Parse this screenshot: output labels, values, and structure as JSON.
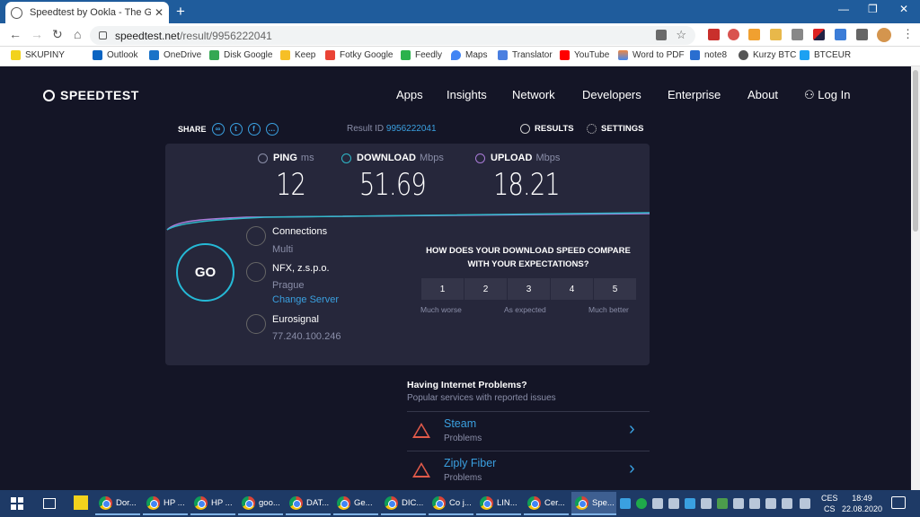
{
  "browser": {
    "tab_title": "Speedtest by Ookla - The Global",
    "tab_close": "✕",
    "new_tab": "+",
    "url_host": "speedtest.net",
    "url_path": "/result/9956222041",
    "bookmarks": [
      "SKUPINY",
      "Outlook",
      "OneDrive",
      "Disk Google",
      "Keep",
      "Fotky Google",
      "Feedly",
      "Maps",
      "Translator",
      "YouTube",
      "Word to PDF",
      "note8",
      "Kurzy BTC",
      "BTCEUR"
    ]
  },
  "site": {
    "logo": "SPEEDTEST",
    "nav": [
      "Apps",
      "Insights",
      "Network",
      "Developers",
      "Enterprise",
      "About"
    ],
    "login": "Log In",
    "share": "SHARE",
    "result_label": "Result ID",
    "result_id": "9956222041",
    "results": "RESULTS",
    "settings": "SETTINGS"
  },
  "metrics": {
    "ping": {
      "label": "PING",
      "unit": "ms",
      "value": "12"
    },
    "download": {
      "label": "DOWNLOAD",
      "unit": "Mbps",
      "value": "51.69"
    },
    "upload": {
      "label": "UPLOAD",
      "unit": "Mbps",
      "value": "18.21"
    }
  },
  "go": "GO",
  "connection": {
    "connections_label": "Connections",
    "connections_value": "Multi",
    "isp": "NFX, z.s.p.o.",
    "server_city": "Prague",
    "change_server": "Change Server",
    "host": "Eurosignal",
    "ip": "77.240.100.246"
  },
  "compare": {
    "question": "HOW DOES YOUR DOWNLOAD SPEED COMPARE WITH YOUR EXPECTATIONS?",
    "ratings": [
      "1",
      "2",
      "3",
      "4",
      "5"
    ],
    "low": "Much worse",
    "mid": "As expected",
    "high": "Much better"
  },
  "problems": {
    "heading": "Having Internet Problems?",
    "subheading": "Popular services with reported issues",
    "items": [
      {
        "name": "Steam",
        "status": "Problems"
      },
      {
        "name": "Ziply Fiber",
        "status": "Problems"
      }
    ]
  },
  "taskbar": {
    "apps": [
      "Dor...",
      "HP ...",
      "HP ...",
      "goo...",
      "DAT...",
      "Ge...",
      "DIC...",
      "Co j...",
      "LIN...",
      "Cer...",
      "Spe..."
    ],
    "lang1": "CES",
    "lang2": "CS",
    "time": "18:49",
    "date": "22.08.2020"
  },
  "colors": {
    "page_bg": "#141526",
    "card_bg": "#26273b",
    "accent": "#3aa0e0",
    "go_ring": "#25b9d6",
    "download_icon": "#2fb8c9",
    "upload_icon": "#a97bd8",
    "warning": "#e05a4a"
  }
}
